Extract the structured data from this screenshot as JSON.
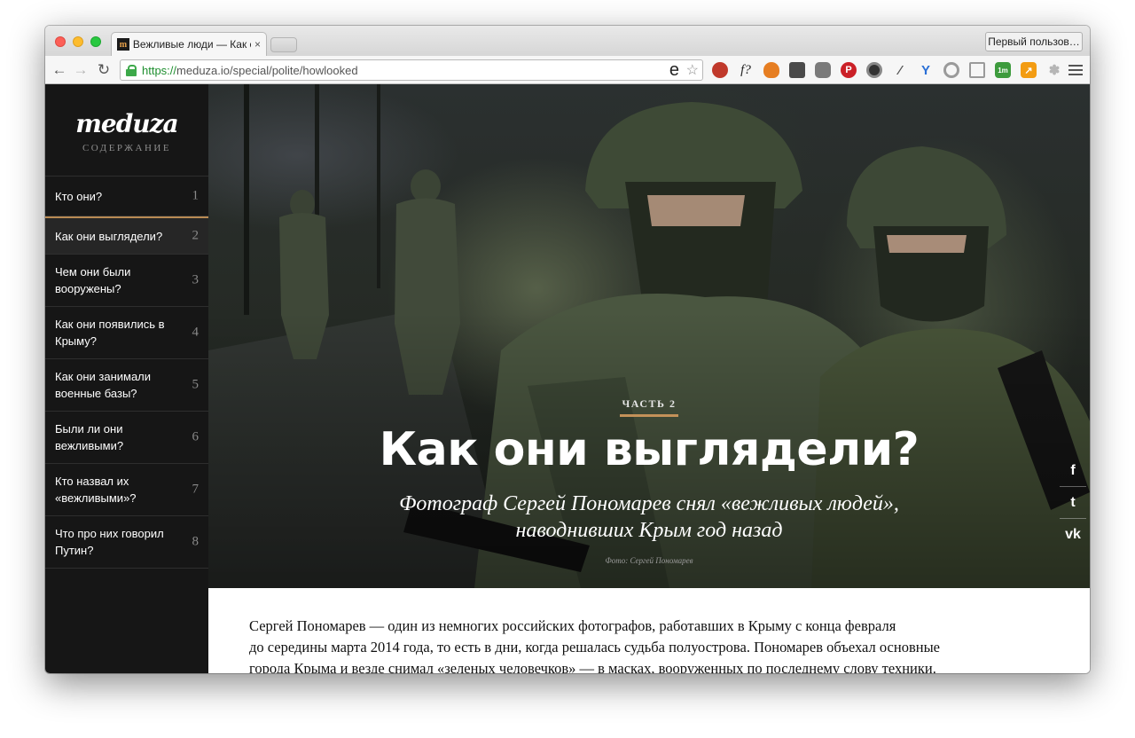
{
  "browser": {
    "tab_title": "Вежливые люди — Как они выглядели?",
    "tab_favicon": "m",
    "tab_close": "×",
    "profile_button": "Первый пользов…",
    "url_scheme": "https://",
    "url_rest": "meduza.io/special/polite/howlooked",
    "extensions": [
      "ublock-icon",
      "f-question-icon",
      "flame-icon",
      "evernote-icon",
      "pocket-icon",
      "pinterest-icon",
      "camera-icon",
      "eyedropper-icon",
      "y-icon",
      "ring-icon",
      "reader-icon",
      "feedly-icon",
      "stats-icon",
      "paw-icon"
    ],
    "extension_badge": "1m"
  },
  "sidebar": {
    "logo": "meduza",
    "caption": "СОДЕРЖАНИЕ",
    "items": [
      {
        "label": "Кто они?",
        "num": "1"
      },
      {
        "label": "Как они выглядели?",
        "num": "2"
      },
      {
        "label": "Чем они были вооружены?",
        "num": "3"
      },
      {
        "label": "Как они появились в Крыму?",
        "num": "4"
      },
      {
        "label": "Как они занимали военные базы?",
        "num": "5"
      },
      {
        "label": "Были ли они вежливыми?",
        "num": "6"
      },
      {
        "label": "Кто назвал их «вежливыми»?",
        "num": "7"
      },
      {
        "label": "Что про них говорил Путин?",
        "num": "8"
      }
    ]
  },
  "hero": {
    "part": "ЧАСТЬ 2",
    "title": "Как они выглядели?",
    "subtitle_line1": "Фотограф Сергей Пономарев снял «вежливых людей»,",
    "subtitle_line2": "наводнивших Крым год назад",
    "credit": "Фото: Сергей Пономарев"
  },
  "share": {
    "facebook": "f",
    "twitter": "t",
    "vk": "vk"
  },
  "article": {
    "line1": "Сергей Пономарев — один из немногих российских фотографов, работавших в Крыму с конца февраля",
    "line2": "до середины марта 2014 года, то есть в дни, когда решалась судьба полуострова. Пономарев объехал основные",
    "line3": "города Крыма и везде снимал «зеленых человечков» — в масках, вооруженных по последнему слову техники."
  }
}
